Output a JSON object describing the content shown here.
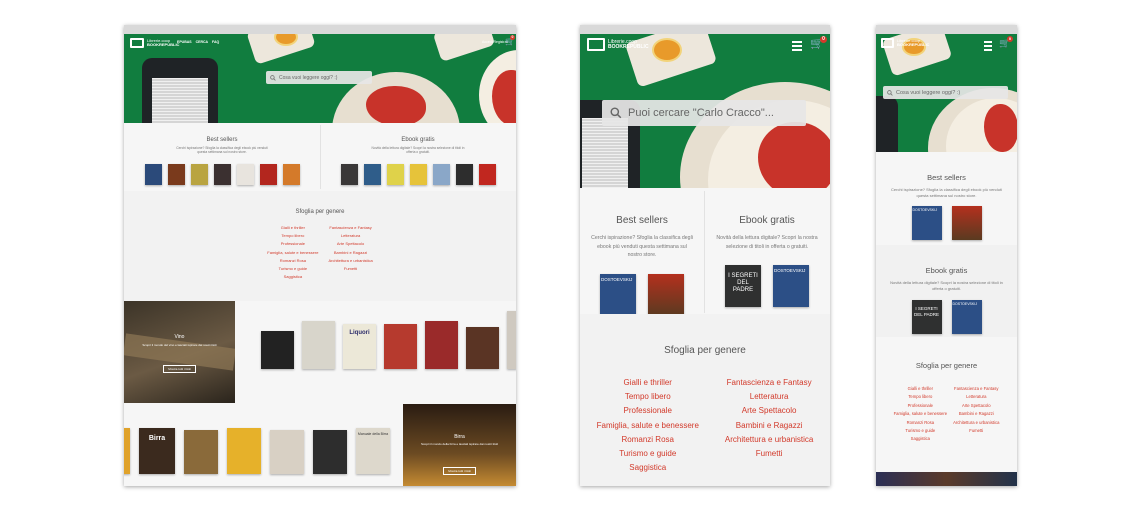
{
  "colors": {
    "brand_green": "#117d3f",
    "accent_red": "#d23a2b",
    "page_bg": "#f6f6f6"
  },
  "desktop": {
    "logo": {
      "line1": "Librerie.coop",
      "line2": "BOOKREPUBLIC"
    },
    "nav": [
      "EPUBAS",
      "CERCA",
      "FAQ"
    ],
    "account": "Accedi/Registrati",
    "cart_badge": "0",
    "search_placeholder": "Cosa vuoi leggere oggi? :)",
    "bestsellers": {
      "title": "Best sellers",
      "desc": "Cerchi ispirazione? Sfoglia la classifica degli ebook più venduti questa settimana sul nostro store."
    },
    "ebookgratis": {
      "title": "Ebook gratis",
      "desc": "Novità della lettura digitale? Scopri la nostra selezione di titoli in offerta o gratuiti."
    },
    "genres": {
      "title": "Sfoglia per genere",
      "left": [
        "Gialli e thriller",
        "Tempo libero",
        "Professionale",
        "Famiglia, salute e benessere",
        "Romanzi Rosa",
        "Turismo e guide",
        "Saggistica"
      ],
      "right": [
        "Fantascienza e Fantasy",
        "Letteratura",
        "Arte Spettacolo",
        "Bambini e Ragazzi",
        "Architettura e urbanistica",
        "Fumetti"
      ]
    },
    "vino": {
      "title": "Vino",
      "desc": "Scopri il mondo del vino e lasciati ispirare dai nostri titoli",
      "button": "Mostra tutti i titoli"
    },
    "birra": {
      "title": "Birra",
      "desc": "Scopri il mondo della birra e lasciati ispirare dai nostri titoli",
      "button": "Mostra tutti i titoli"
    },
    "book_titles": {
      "liquori": "Liquori",
      "birra": "Birra",
      "compact": "Manuale della Birra"
    }
  },
  "tablet": {
    "logo": {
      "line1": "Librerie.coop",
      "line2": "BOOKREPUBLIC"
    },
    "cart_badge": "0",
    "search_placeholder": "Puoi cercare \"Carlo Cracco\"...",
    "bestsellers": {
      "title": "Best sellers",
      "desc": "Cerchi ispirazione? Sfoglia la classifica degli ebook più venduti questa settimana sul nostro store."
    },
    "ebookgratis": {
      "title": "Ebook gratis",
      "desc": "Novità della lettura digitale? Scopri la nostra selezione di titoli in offerta o gratuiti."
    },
    "genres": {
      "title": "Sfoglia per genere",
      "left": [
        "Gialli e thriller",
        "Tempo libero",
        "Professionale",
        "Famiglia, salute e benessere",
        "Romanzi Rosa",
        "Turismo e guide",
        "Saggistica"
      ],
      "right": [
        "Fantascienza e Fantasy",
        "Letteratura",
        "Arte Spettacolo",
        "Bambini e Ragazzi",
        "Architettura e urbanistica",
        "Fumetti"
      ]
    },
    "books": {
      "b1": "DOSTOEVSKIJ",
      "b3": "I SEGRETI DEL PADRE",
      "b4": "DOSTOEVSKIJ"
    }
  },
  "mobile": {
    "logo": {
      "line1": "Librerie.coop",
      "line2": "BOOKREPUBLIC"
    },
    "cart_badge": "0",
    "search_placeholder": "Cosa vuoi leggere oggi? :)",
    "bestsellers": {
      "title": "Best sellers",
      "desc": "Cerchi ispirazione? Sfoglia la classifica degli ebook più venduti questa settimana sul nostro store."
    },
    "ebookgratis": {
      "title": "Ebook gratis",
      "desc": "Novità della lettura digitale? Scopri la nostra selezione di titoli in offerta o gratuiti."
    },
    "genres": {
      "title": "Sfoglia per genere",
      "left": [
        "Gialli e thriller",
        "Tempo libero",
        "Professionale",
        "Famiglia, salute e benessere",
        "Romanzi Rosa",
        "Turismo e guide",
        "Saggistica"
      ],
      "right": [
        "Fantascienza e Fantasy",
        "Letteratura",
        "Arte Spettacolo",
        "Bambini e Ragazzi",
        "Architettura e urbanistica",
        "Fumetti"
      ]
    },
    "books": {
      "b1": "DOSTOEVSKIJ",
      "b3": "I SEGRETI DEL PADRE",
      "b4": "DOSTOEVSKIJ"
    }
  }
}
